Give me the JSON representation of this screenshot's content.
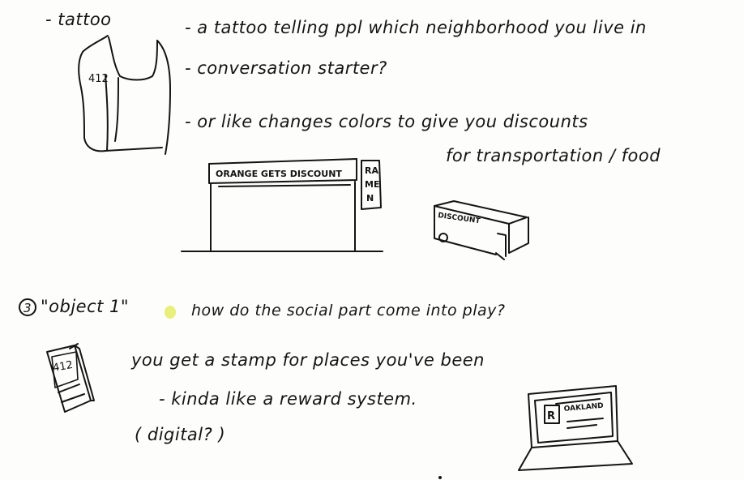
{
  "section1": {
    "heading": "- tattoo",
    "notes": [
      "- a tattoo telling ppl which neighborhood you live in",
      "- conversation starter?",
      "- or like changes colors to give you discounts",
      "for transportation / food"
    ],
    "arm_tattoo_text": "412",
    "storefront_sign": "ORANGE GETS DISCOUNT",
    "ramen_sign": [
      "RA",
      "ME",
      "N"
    ],
    "bus_label": "DISCOUNT"
  },
  "section2": {
    "number": "3",
    "heading": "\"object 1\"",
    "question": "how do the social part come into play?",
    "notes": [
      "you get a stamp for places you've been",
      "- kinda like a reward system.",
      "( digital? )"
    ],
    "booklet_text": "412",
    "card_letter": "R",
    "card_text": "OAKLAND"
  },
  "colors": {
    "ink": "#141414",
    "highlight": "#e8ef7a",
    "paper": "#fdfdfb"
  }
}
